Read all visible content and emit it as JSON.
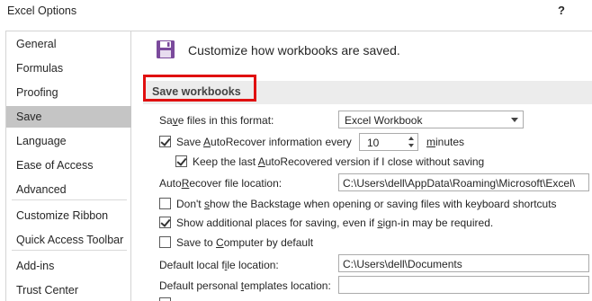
{
  "window": {
    "title": "Excel Options",
    "help": "?"
  },
  "sidebar": {
    "items": [
      {
        "label": "General"
      },
      {
        "label": "Formulas"
      },
      {
        "label": "Proofing"
      },
      {
        "label": "Save",
        "selected": true
      },
      {
        "label": "Language"
      },
      {
        "label": "Ease of Access"
      },
      {
        "label": "Advanced"
      },
      {
        "label": "Customize Ribbon"
      },
      {
        "label": "Quick Access Toolbar"
      },
      {
        "label": "Add-ins"
      },
      {
        "label": "Trust Center"
      }
    ]
  },
  "main": {
    "header_icon": "save-icon",
    "header_text": "Customize how workbooks are saved.",
    "section_title": "Save workbooks",
    "format": {
      "label_pre": "Sa",
      "label_u": "v",
      "label_post": "e files in this format:",
      "value": "Excel Workbook"
    },
    "autorecover": {
      "label_pre": "Save ",
      "label_u": "A",
      "label_post": "utoRecover information every",
      "checked": true,
      "minutes_value": "10",
      "minutes_u": "m",
      "minutes_post": "inutes"
    },
    "keep_last": {
      "label_pre": "Keep the last ",
      "label_u": "A",
      "label_post": "utoRecovered version if I close without saving",
      "checked": true
    },
    "ar_location": {
      "label_pre": "Auto",
      "label_u": "R",
      "label_post": "ecover file location:",
      "value": "C:\\Users\\dell\\AppData\\Roaming\\Microsoft\\Excel\\"
    },
    "backstage": {
      "label_pre": "Don't ",
      "label_u": "s",
      "label_post": "how the Backstage when opening or saving files with keyboard shortcuts",
      "checked": false
    },
    "additional": {
      "label_pre": "Show additional places for saving, even if ",
      "label_u": "s",
      "label_post": "ign-in may be required.",
      "checked": true
    },
    "computer": {
      "label_pre": "Save to ",
      "label_u": "C",
      "label_post": "omputer by default",
      "checked": false
    },
    "local": {
      "label_pre": "Default local f",
      "label_u": "i",
      "label_post": "le location:",
      "value": "C:\\Users\\dell\\Documents"
    },
    "personal": {
      "label_pre": "Default personal ",
      "label_u": "t",
      "label_post": "emplates location:",
      "value": ""
    }
  },
  "colors": {
    "selected_nav": "#c5c5c5",
    "highlight": "#e01010",
    "save_icon": "#7b4a9c"
  }
}
